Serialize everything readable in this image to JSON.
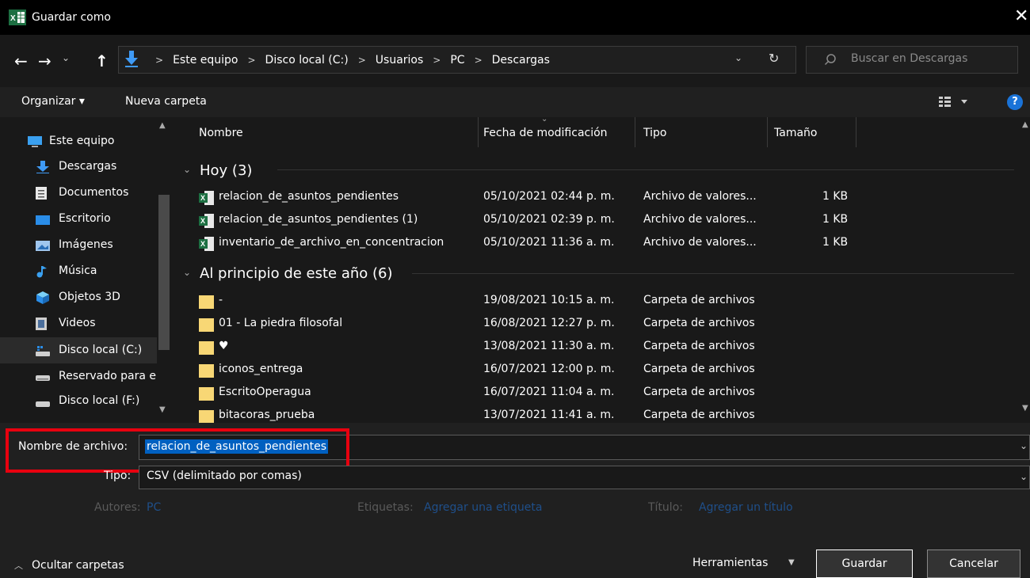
{
  "window": {
    "title": "Guardar como",
    "app_icon": "excel-icon",
    "close_glyph": "✕"
  },
  "nav": {
    "back": "←",
    "forward": "→",
    "recent": "⌄",
    "up": "↑",
    "breadcrumbs": [
      "Este equipo",
      "Disco local (C:)",
      "Usuarios",
      "PC",
      "Descargas"
    ],
    "refresh": "↻",
    "search_placeholder": "Buscar en Descargas"
  },
  "toolbar": {
    "organize": "Organizar ▾",
    "new_folder": "Nueva carpeta",
    "view_icon": "view-options-icon",
    "help": "?"
  },
  "sidebar": {
    "items": [
      {
        "label": "Este equipo",
        "icon": "pc-icon"
      },
      {
        "label": "Descargas",
        "icon": "download-icon"
      },
      {
        "label": "Documentos",
        "icon": "document-icon"
      },
      {
        "label": "Escritorio",
        "icon": "desktop-icon"
      },
      {
        "label": "Imágenes",
        "icon": "pictures-icon"
      },
      {
        "label": "Música",
        "icon": "music-icon"
      },
      {
        "label": "Objetos 3D",
        "icon": "objects3d-icon"
      },
      {
        "label": "Videos",
        "icon": "video-icon"
      },
      {
        "label": "Disco local (C:)",
        "icon": "drive-icon"
      },
      {
        "label": "Reservado para e",
        "icon": "drive-icon"
      },
      {
        "label": "Disco local (F:)",
        "icon": "drive-icon"
      }
    ]
  },
  "columns": {
    "name": "Nombre",
    "date": "Fecha de modificación",
    "type": "Tipo",
    "size": "Tamaño"
  },
  "groups": [
    {
      "header": "Hoy (3)",
      "files": [
        {
          "name": "relacion_de_asuntos_pendientes",
          "date": "05/10/2021 02:44 p. m.",
          "type": "Archivo de valores...",
          "size": "1 KB",
          "icon": "csv-icon"
        },
        {
          "name": "relacion_de_asuntos_pendientes (1)",
          "date": "05/10/2021 02:39 p. m.",
          "type": "Archivo de valores...",
          "size": "1 KB",
          "icon": "csv-icon"
        },
        {
          "name": "inventario_de_archivo_en_concentracion",
          "date": "05/10/2021 11:36 a. m.",
          "type": "Archivo de valores...",
          "size": "1 KB",
          "icon": "csv-icon"
        }
      ]
    },
    {
      "header": "Al principio de este año (6)",
      "files": [
        {
          "name": "-",
          "date": "19/08/2021 10:15 a. m.",
          "type": "Carpeta de archivos",
          "size": "",
          "icon": "folder-icon"
        },
        {
          "name": "01 - La piedra filosofal",
          "date": "16/08/2021 12:27 p. m.",
          "type": "Carpeta de archivos",
          "size": "",
          "icon": "folder-icon"
        },
        {
          "name": "♥",
          "date": "13/08/2021 11:30 a. m.",
          "type": "Carpeta de archivos",
          "size": "",
          "icon": "folder-icon"
        },
        {
          "name": "iconos_entrega",
          "date": "16/07/2021 12:00 p. m.",
          "type": "Carpeta de archivos",
          "size": "",
          "icon": "folder-icon"
        },
        {
          "name": "EscritoOperagua",
          "date": "16/07/2021 11:04 a. m.",
          "type": "Carpeta de archivos",
          "size": "",
          "icon": "folder-icon"
        },
        {
          "name": "bitacoras_prueba",
          "date": "13/07/2021 11:41 a. m.",
          "type": "Carpeta de archivos",
          "size": "",
          "icon": "folder-icon"
        }
      ]
    }
  ],
  "form": {
    "filename_label": "Nombre de archivo:",
    "filename_value": "relacion_de_asuntos_pendientes",
    "type_label": "Tipo:",
    "type_value": "CSV (delimitado por comas)",
    "authors_label": "Autores:",
    "authors_value": "PC",
    "tags_label": "Etiquetas:",
    "tags_value": "Agregar una etiqueta",
    "title_label": "Título:",
    "title_value": "Agregar un título"
  },
  "footer": {
    "hide_folders": "Ocultar carpetas",
    "tools": "Herramientas",
    "save": "Guardar",
    "cancel": "Cancelar"
  },
  "colors": {
    "highlight_box": "#e8000f",
    "selection": "#0060c0",
    "folder": "#f8d775",
    "excel": "#1d6f42"
  }
}
